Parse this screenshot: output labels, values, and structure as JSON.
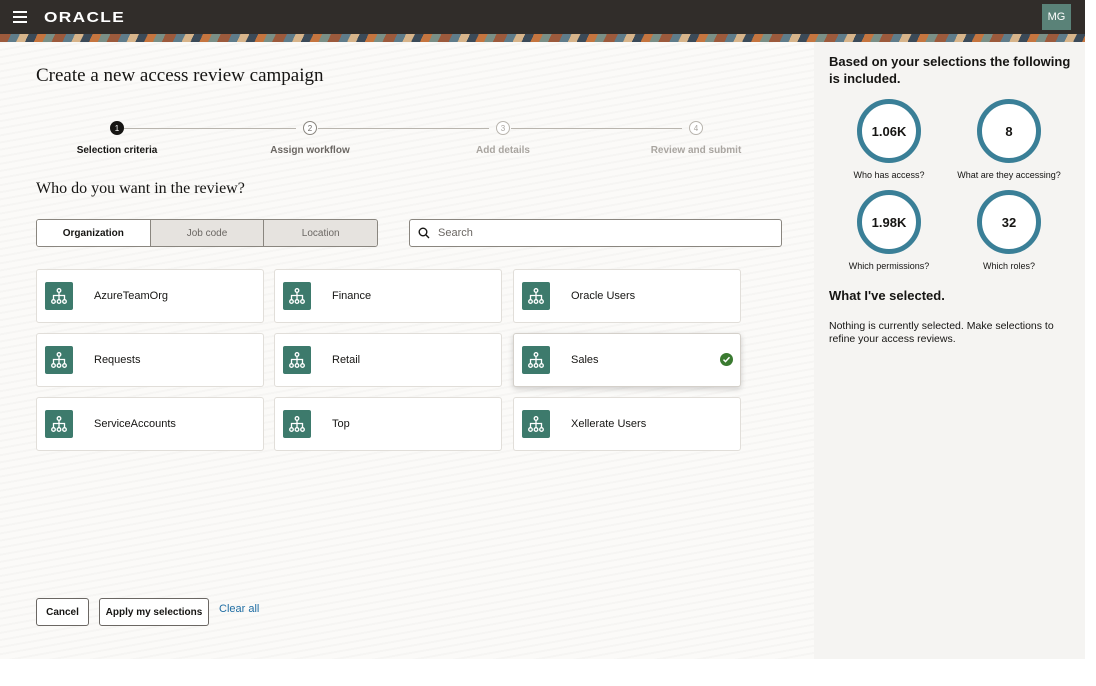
{
  "header": {
    "logo": "ORACLE",
    "avatar_initials": "MG"
  },
  "page": {
    "title": "Create a new access review campaign"
  },
  "stepper": {
    "steps": [
      {
        "number": "1",
        "label": "Selection criteria",
        "state": "current"
      },
      {
        "number": "2",
        "label": "Assign workflow",
        "state": "next"
      },
      {
        "number": "3",
        "label": "Add details",
        "state": "disabled"
      },
      {
        "number": "4",
        "label": "Review and submit",
        "state": "disabled"
      }
    ]
  },
  "section": {
    "title": "Who do you want in the review?"
  },
  "tabs": [
    {
      "label": "Organization",
      "selected": true
    },
    {
      "label": "Job code",
      "selected": false
    },
    {
      "label": "Location",
      "selected": false
    }
  ],
  "search": {
    "placeholder": "Search",
    "value": ""
  },
  "organizations": [
    {
      "label": "AzureTeamOrg",
      "selected": false,
      "icon": "org-chart-icon"
    },
    {
      "label": "Finance",
      "selected": false,
      "icon": "org-chart-icon"
    },
    {
      "label": "Oracle Users",
      "selected": false,
      "icon": "org-chart-icon"
    },
    {
      "label": "Requests",
      "selected": false,
      "icon": "org-chart-icon"
    },
    {
      "label": "Retail",
      "selected": false,
      "icon": "org-chart-icon"
    },
    {
      "label": "Sales",
      "selected": true,
      "icon": "org-chart-icon"
    },
    {
      "label": "ServiceAccounts",
      "selected": false,
      "icon": "org-chart-icon"
    },
    {
      "label": "Top",
      "selected": false,
      "icon": "org-chart-icon"
    },
    {
      "label": "Xellerate Users",
      "selected": false,
      "icon": "org-chart-icon"
    }
  ],
  "footer": {
    "cancel_label": "Cancel",
    "apply_label": "Apply my selections",
    "clear_label": "Clear all"
  },
  "panel": {
    "title": "Based on your selections the following is included.",
    "stats": [
      {
        "value": "1.06K",
        "label": "Who has access?"
      },
      {
        "value": "8",
        "label": "What are they accessing?"
      },
      {
        "value": "1.98K",
        "label": "Which permissions?"
      },
      {
        "value": "32",
        "label": "Which roles?"
      }
    ],
    "selected_title": "What I've selected.",
    "selected_text": "Nothing is currently selected. Make selections to refine your access reviews."
  },
  "colors": {
    "header": "#312d2a",
    "icon_tile": "#3d7a6c",
    "ring": "#3a7f97",
    "check": "#3a7a30",
    "link": "#1f6da3"
  }
}
